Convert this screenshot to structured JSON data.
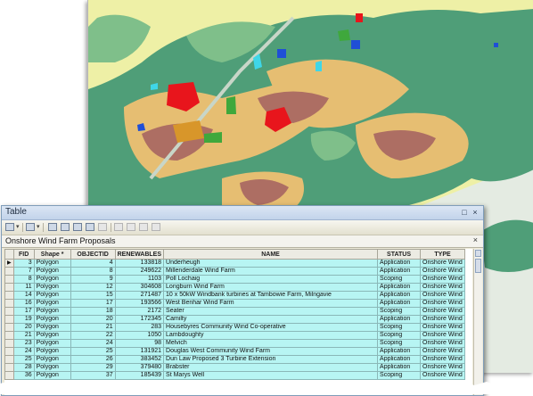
{
  "window": {
    "title": "Table",
    "pin_glyph": "□",
    "close_glyph": "×"
  },
  "tab": {
    "title": "Onshore Wind Farm Proposals",
    "close_glyph": "×"
  },
  "toolbar_icons": [
    "table-options-icon",
    "related-tables-icon",
    "select-by-attributes-icon",
    "switch-selection-icon",
    "clear-selection-icon",
    "zoom-to-selected-icon",
    "delete-selected-icon",
    "copy-selection-icon",
    "paste-icon",
    "calculate-icon",
    "delete-icon"
  ],
  "table": {
    "columns": [
      "FID",
      "Shape *",
      "OBJECTID",
      "RENEWABLES",
      "NAME",
      "STATUS",
      "TYPE"
    ],
    "current_row_marker": "▶",
    "rows": [
      {
        "fid": "3",
        "shape": "Polygon",
        "objectid": "4",
        "renewables": "133818",
        "name": "Underheugh",
        "status": "Application",
        "type": "Onshore Wind"
      },
      {
        "fid": "7",
        "shape": "Polygon",
        "objectid": "8",
        "renewables": "249622",
        "name": "Millenderdale Wind Farm",
        "status": "Application",
        "type": "Onshore Wind"
      },
      {
        "fid": "8",
        "shape": "Polygon",
        "objectid": "9",
        "renewables": "1103",
        "name": "Poll Lochaig",
        "status": "Scoping",
        "type": "Onshore Wind"
      },
      {
        "fid": "11",
        "shape": "Polygon",
        "objectid": "12",
        "renewables": "304608",
        "name": "Longburn Wind Farm",
        "status": "Application",
        "type": "Onshore Wind"
      },
      {
        "fid": "14",
        "shape": "Polygon",
        "objectid": "15",
        "renewables": "271487",
        "name": "10 x 50kW Windbank turbines at Tambowie Farm, Milngavie",
        "status": "Application",
        "type": "Onshore Wind"
      },
      {
        "fid": "16",
        "shape": "Polygon",
        "objectid": "17",
        "renewables": "193566",
        "name": "West Benhar Wind Farm",
        "status": "Application",
        "type": "Onshore Wind"
      },
      {
        "fid": "17",
        "shape": "Polygon",
        "objectid": "18",
        "renewables": "2172",
        "name": "Seater",
        "status": "Scoping",
        "type": "Onshore Wind"
      },
      {
        "fid": "19",
        "shape": "Polygon",
        "objectid": "20",
        "renewables": "172345",
        "name": "Camilty",
        "status": "Application",
        "type": "Onshore Wind"
      },
      {
        "fid": "20",
        "shape": "Polygon",
        "objectid": "21",
        "renewables": "283",
        "name": "Housebyres Community Wind Co-operative",
        "status": "Scoping",
        "type": "Onshore Wind"
      },
      {
        "fid": "21",
        "shape": "Polygon",
        "objectid": "22",
        "renewables": "1050",
        "name": "Lambdoughty",
        "status": "Scoping",
        "type": "Onshore Wind"
      },
      {
        "fid": "23",
        "shape": "Polygon",
        "objectid": "24",
        "renewables": "98",
        "name": "Melvich",
        "status": "Scoping",
        "type": "Onshore Wind"
      },
      {
        "fid": "24",
        "shape": "Polygon",
        "objectid": "25",
        "renewables": "131921",
        "name": "Douglas West Community Wind Farm",
        "status": "Application",
        "type": "Onshore Wind"
      },
      {
        "fid": "25",
        "shape": "Polygon",
        "objectid": "26",
        "renewables": "383452",
        "name": "Dun Law Proposed 3 Turbine Extension",
        "status": "Application",
        "type": "Onshore Wind"
      },
      {
        "fid": "28",
        "shape": "Polygon",
        "objectid": "29",
        "renewables": "379480",
        "name": "Brabster",
        "status": "Application",
        "type": "Onshore Wind"
      },
      {
        "fid": "36",
        "shape": "Polygon",
        "objectid": "37",
        "renewables": "185439",
        "name": "St Marys Well",
        "status": "Scoping",
        "type": "Onshore Wind"
      }
    ]
  },
  "colors": {
    "cell_highlight": "#b7f5f3",
    "map_green_dark": "#4f9e78",
    "map_green_light": "#7fbf8a",
    "map_tan": "#e6be72",
    "map_brown": "#ad6e63",
    "map_yellow": "#eef0a6",
    "map_red": "#e8151c",
    "map_blue": "#1f4fd6",
    "map_cyan": "#3fd6e8",
    "map_orange": "#d8962a"
  }
}
